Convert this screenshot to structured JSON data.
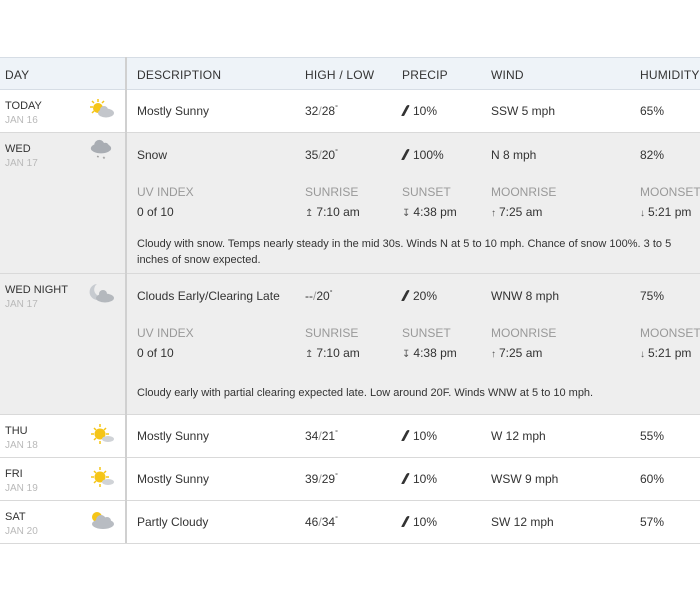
{
  "headers": {
    "day": "DAY",
    "description": "DESCRIPTION",
    "highlow": "HIGH / LOW",
    "precip": "PRECIP",
    "wind": "WIND",
    "humidity": "HUMIDITY"
  },
  "detail_labels": {
    "uv": "UV INDEX",
    "sunrise": "SUNRISE",
    "sunset": "SUNSET",
    "moonrise": "MOONRISE",
    "moonset": "MOONSET"
  },
  "rows": [
    {
      "day": "TODAY",
      "date": "JAN 16",
      "icon": "sun-cloud-icon",
      "desc": "Mostly Sunny",
      "high": "32",
      "low": "28",
      "precip": "10%",
      "wind": "SSW 5 mph",
      "humidity": "65%"
    },
    {
      "day": "WED",
      "date": "JAN 17",
      "icon": "snow-cloud-icon",
      "desc": "Snow",
      "high": "35",
      "low": "20",
      "precip": "100%",
      "wind": "N 8 mph",
      "humidity": "82%",
      "uv": "0 of 10",
      "sunrise": "7:10 am",
      "sunset": "4:38 pm",
      "moonrise": "7:25 am",
      "moonset": "5:21 pm",
      "details": "Cloudy with snow. Temps nearly steady in the mid 30s. Winds N at 5 to 10 mph. Chance of snow 100%. 3 to 5 inches of snow expected."
    },
    {
      "day": "WED NIGHT",
      "date": "JAN 17",
      "icon": "moon-cloud-icon",
      "desc": "Clouds Early/Clearing Late",
      "high": "--",
      "low": "20",
      "precip": "20%",
      "wind": "WNW 8 mph",
      "humidity": "75%",
      "uv": "0 of 10",
      "sunrise": "7:10 am",
      "sunset": "4:38 pm",
      "moonrise": "7:25 am",
      "moonset": "5:21 pm",
      "details": "Cloudy early with partial clearing expected late. Low around 20F. Winds WNW at 5 to 10 mph."
    },
    {
      "day": "THU",
      "date": "JAN 18",
      "icon": "sun-icon",
      "desc": "Mostly Sunny",
      "high": "34",
      "low": "21",
      "precip": "10%",
      "wind": "W 12 mph",
      "humidity": "55%"
    },
    {
      "day": "FRI",
      "date": "JAN 19",
      "icon": "sun-icon",
      "desc": "Mostly Sunny",
      "high": "39",
      "low": "29",
      "precip": "10%",
      "wind": "WSW 9 mph",
      "humidity": "60%"
    },
    {
      "day": "SAT",
      "date": "JAN 20",
      "icon": "partly-cloudy-icon",
      "desc": "Partly Cloudy",
      "high": "46",
      "low": "34",
      "precip": "10%",
      "wind": "SW 12 mph",
      "humidity": "57%"
    }
  ],
  "colors": {
    "sun": "#f5c518",
    "cloud": "#b8bcc2",
    "header_bg": "#eef3f8",
    "expanded_bg": "#eeeeee"
  }
}
